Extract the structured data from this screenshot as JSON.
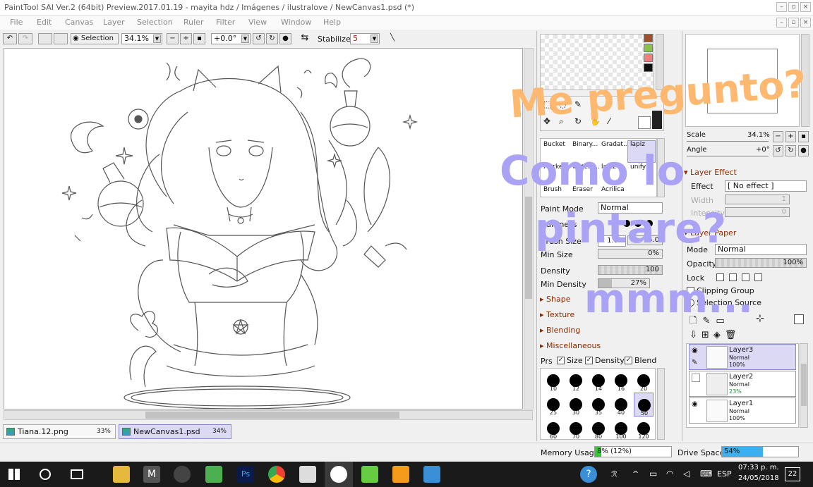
{
  "window": {
    "title": "PaintTool SAI Ver.2 (64bit) Preview.2017.01.19 - mayita hdz / Imágenes / ilustralove / NewCanvas1.psd (*)"
  },
  "menu": [
    "File",
    "Edit",
    "Canvas",
    "Layer",
    "Selection",
    "Ruler",
    "Filter",
    "View",
    "Window",
    "Help"
  ],
  "toolbar": {
    "selection_label": "Selection",
    "zoom": "34.1%",
    "angle": "+0.0°",
    "stabilizer_label": "Stabilizer",
    "stabilizer_value": "5"
  },
  "tabs": [
    {
      "name": "Tiana.12.png",
      "zoom": "33%"
    },
    {
      "name": "NewCanvas1.psd",
      "zoom": "34%"
    }
  ],
  "tools": [
    {
      "label": "Bucket"
    },
    {
      "label": "Binary..."
    },
    {
      "label": "Gradat..."
    },
    {
      "label": "lapiz"
    },
    {
      "label": "Marker"
    },
    {
      "label": "waterc..."
    },
    {
      "label": "lapiz"
    },
    {
      "label": "unify"
    },
    {
      "label": "Brush"
    },
    {
      "label": "Eraser"
    },
    {
      "label": "Acrilica"
    },
    {
      "label": ""
    }
  ],
  "brush_settings": {
    "paint_mode_label": "Paint Mode",
    "paint_mode": "Normal",
    "hardness_label": "Hardness",
    "brush_size_label": "Brush Size",
    "brush_size_mult": "x 1.0",
    "brush_size": "5.0",
    "min_size_label": "Min Size",
    "min_size": "0%",
    "density_label": "Density",
    "density": "100",
    "min_density_label": "Min Density",
    "min_density": "27%",
    "sections": [
      "Blending",
      "Miscellaneous"
    ],
    "partial_sections": [
      "Shape",
      "Texture"
    ],
    "prs_label": "Prs",
    "prs_size": "Size",
    "prs_density": "Density",
    "prs_blend": "Blend"
  },
  "brush_sizes": [
    [
      "10",
      "12",
      "14",
      "16",
      "20"
    ],
    [
      "25",
      "30",
      "35",
      "40",
      "50"
    ],
    [
      "60",
      "70",
      "80",
      "100",
      "120"
    ]
  ],
  "navigator": {
    "scale_label": "Scale",
    "scale": "34.1%",
    "angle_label": "Angle",
    "angle": "+0°"
  },
  "layer_effect": {
    "header": "Layer Effect",
    "effect_label": "Effect",
    "effect": "[ No effect ]",
    "width_label": "Width",
    "width": "1",
    "intensity_label": "Intensity",
    "intensity": "0"
  },
  "layer_paper": {
    "header": "Layer Paper",
    "mode_label": "Mode",
    "mode": "Normal",
    "opacity_label": "Opacity",
    "opacity": "100%",
    "lock_label": "Lock",
    "clipping_group": "Clipping Group",
    "selection_source": "Selection Source"
  },
  "layers": [
    {
      "name": "Layer3",
      "mode": "Normal",
      "opacity": "100%",
      "opacity_pct": 100,
      "selected": true
    },
    {
      "name": "Layer2",
      "mode": "Normal",
      "opacity": "23%",
      "opacity_pct": 23,
      "selected": false
    },
    {
      "name": "Layer1",
      "mode": "Normal",
      "opacity": "100%",
      "opacity_pct": 100,
      "selected": false
    }
  ],
  "status": {
    "memory_label": "Memory Usage",
    "memory": "8% (12%)",
    "memory_pct": 8,
    "drive_label": "Drive Space",
    "drive": "54%",
    "drive_pct": 54
  },
  "overlay_text": {
    "line1": "Me pregunto?",
    "line2": "Como lo",
    "line3": "pintare?",
    "line4": "mmm..."
  },
  "taskbar": {
    "lang": "ESP",
    "time": "07:33 p. m.",
    "date": "24/05/2018",
    "notif": "22"
  },
  "colors": {
    "selected": "#dcd9f5",
    "overlay_orange": "#ffb870",
    "overlay_purple": "#aaa2f5",
    "taskbar": "#1a1a1a",
    "memory_bar": "#3c3",
    "drive_bar": "#3ab0f0"
  }
}
